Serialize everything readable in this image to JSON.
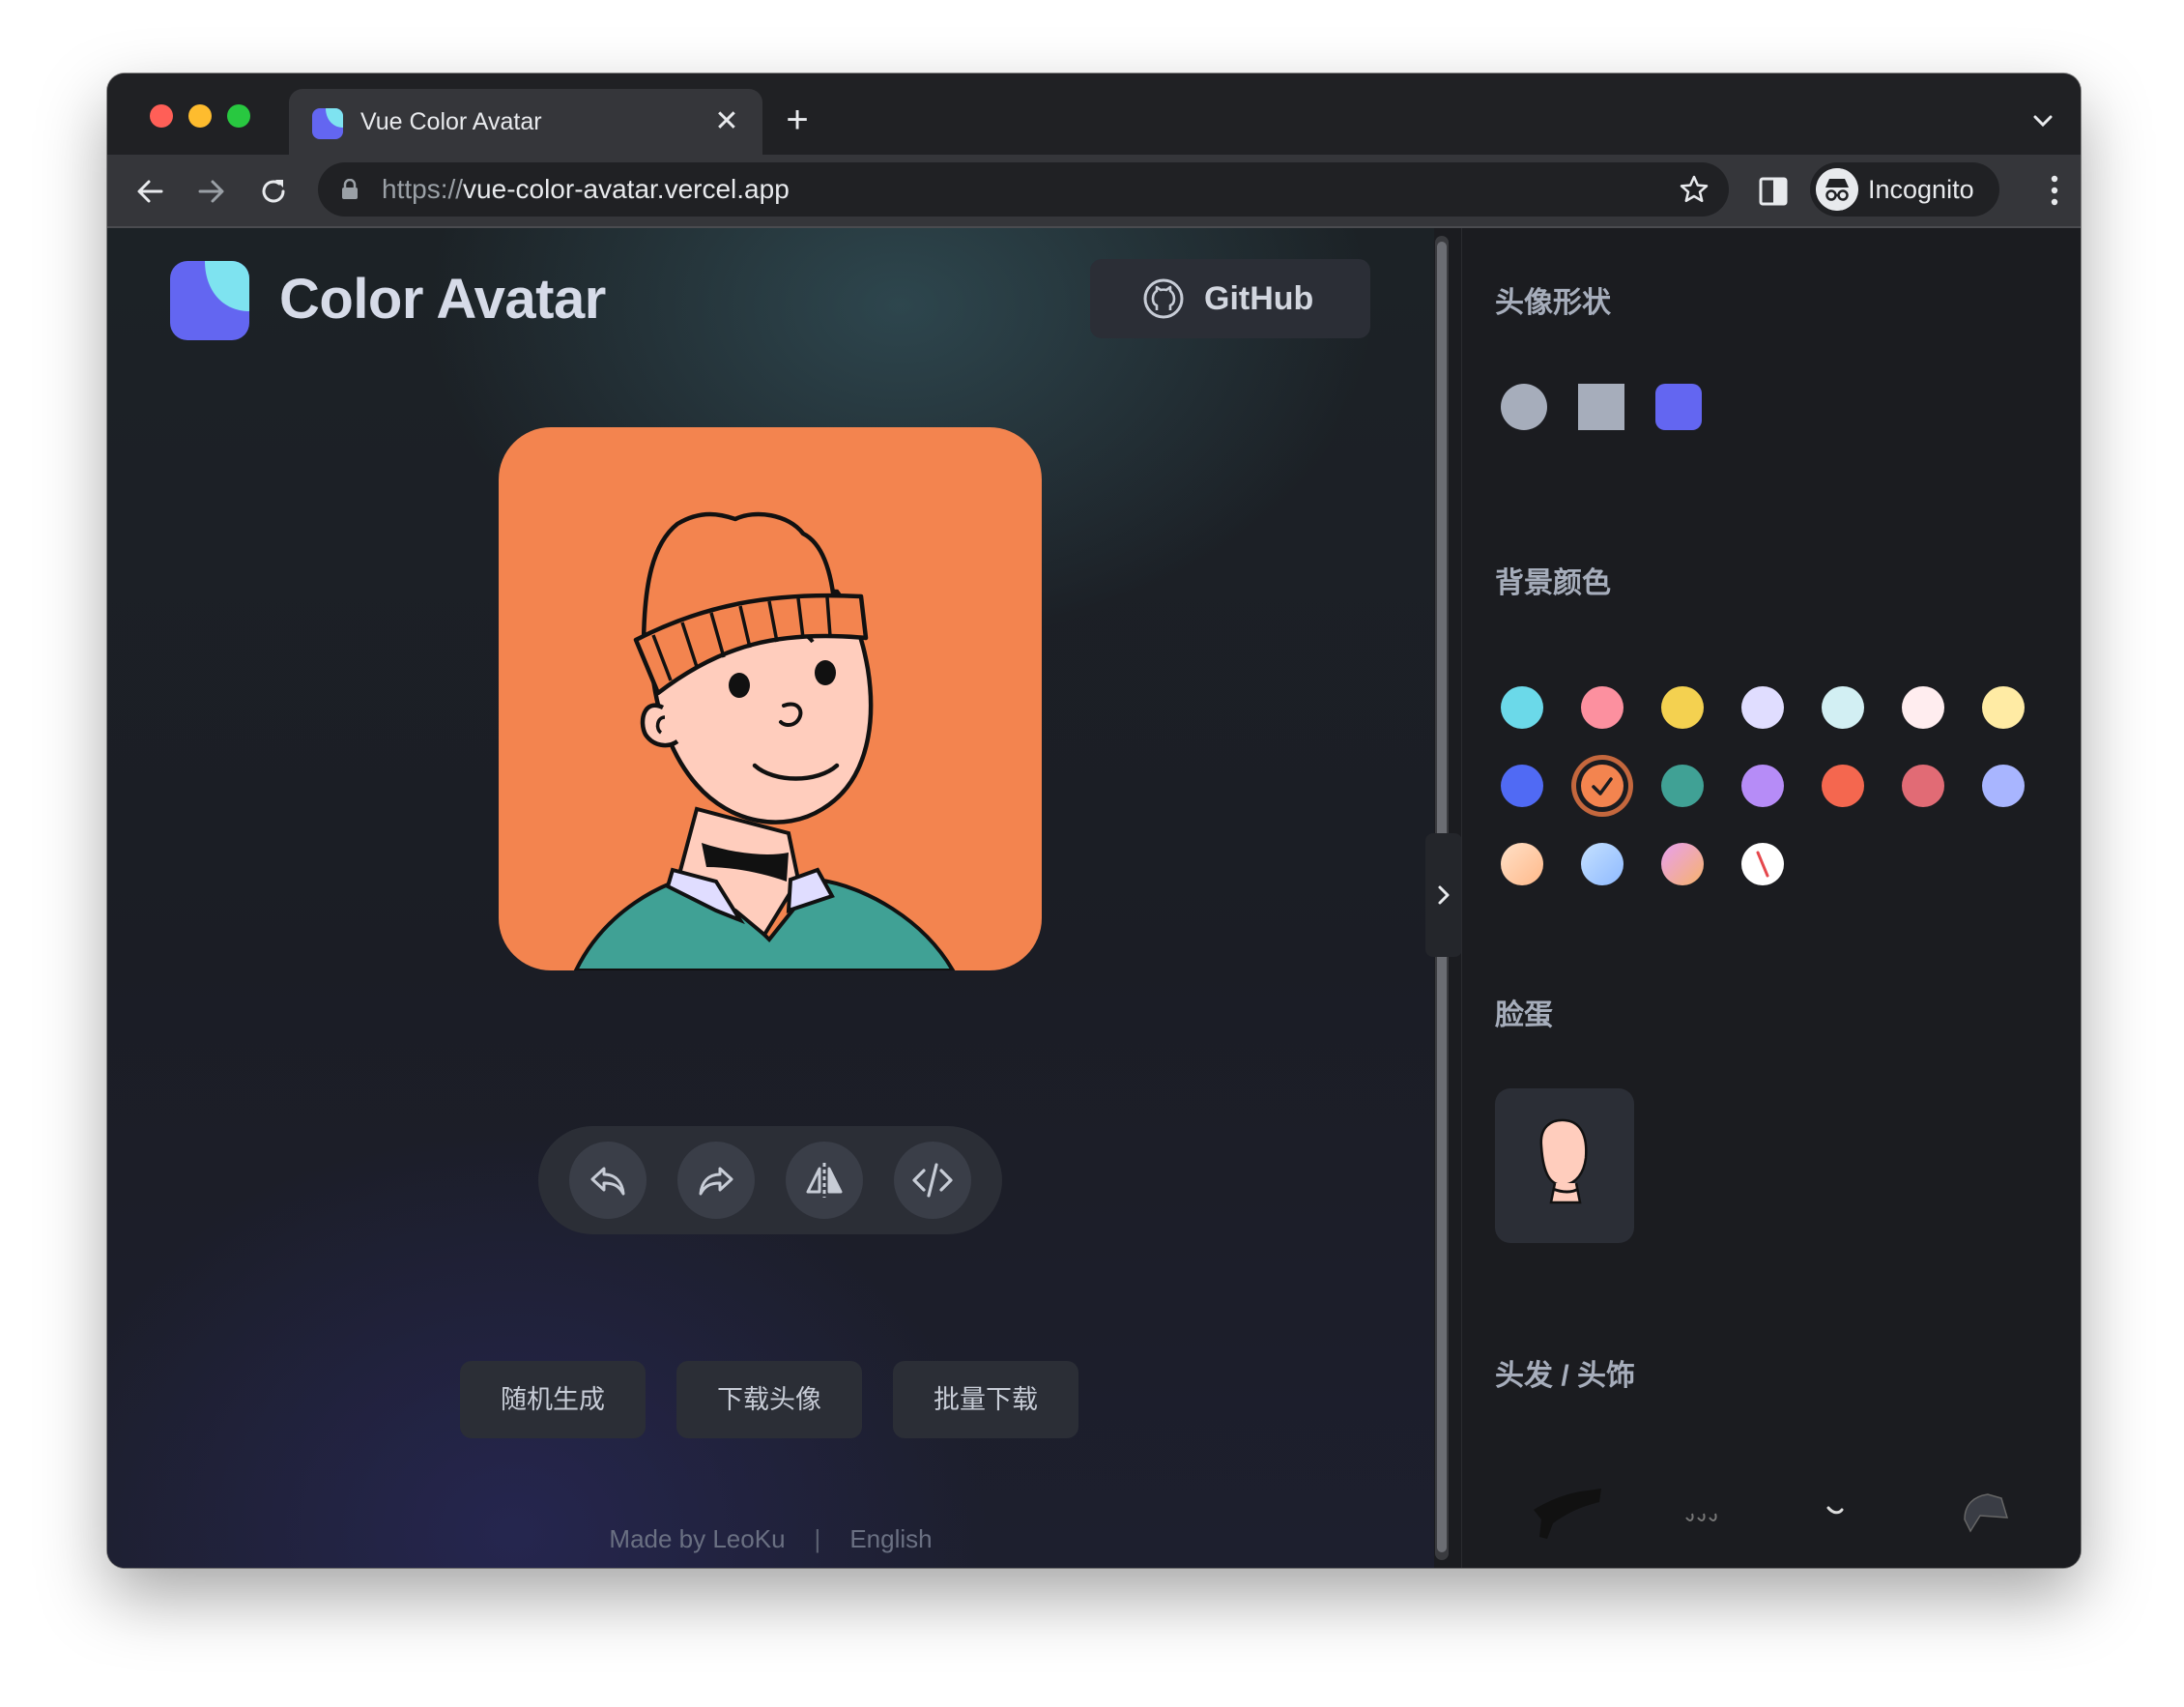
{
  "browser": {
    "tab": {
      "title": "Vue Color Avatar"
    },
    "address": {
      "scheme": "https://",
      "host": "vue-color-avatar.vercel.app"
    },
    "profile": {
      "label": "Incognito"
    }
  },
  "header": {
    "app_title": "Color Avatar",
    "github_label": "GitHub"
  },
  "avatar": {
    "background_color": "#f3844f",
    "shape": "squircle"
  },
  "actions": {
    "icons": [
      "undo-icon",
      "redo-icon",
      "flip-icon",
      "code-icon"
    ]
  },
  "buttons": {
    "random": "随机生成",
    "download": "下载头像",
    "batch_download": "批量下载"
  },
  "footer": {
    "made_by": "Made by LeoKu",
    "separator": "|",
    "language": "English"
  },
  "panel": {
    "shape_title": "头像形状",
    "shapes": [
      {
        "name": "circle",
        "color": "#a6adbb"
      },
      {
        "name": "square",
        "color": "#a6adbb"
      },
      {
        "name": "squircle",
        "color": "#6366f1",
        "selected": true
      }
    ],
    "background_title": "背景颜色",
    "background_colors": [
      "#6bd9e9",
      "#fc909f",
      "#f4d150",
      "#e0ddff",
      "#d2eff3",
      "#ffedef",
      "#ffeba4",
      "#506af4",
      "#f3844f",
      "#40a195",
      "#b68cf7",
      "#f4674f",
      "#e16b75",
      "#a8b5ff",
      "gradient-peach",
      "gradient-blue",
      "gradient-pink",
      "transparent"
    ],
    "selected_background_index": 8,
    "face_title": "脸蛋",
    "hair_title": "头发 / 头饰"
  },
  "colors": {
    "accent": "#6366f1",
    "page_bg": "#1b1c20",
    "button_bg": "#2b2e36"
  }
}
